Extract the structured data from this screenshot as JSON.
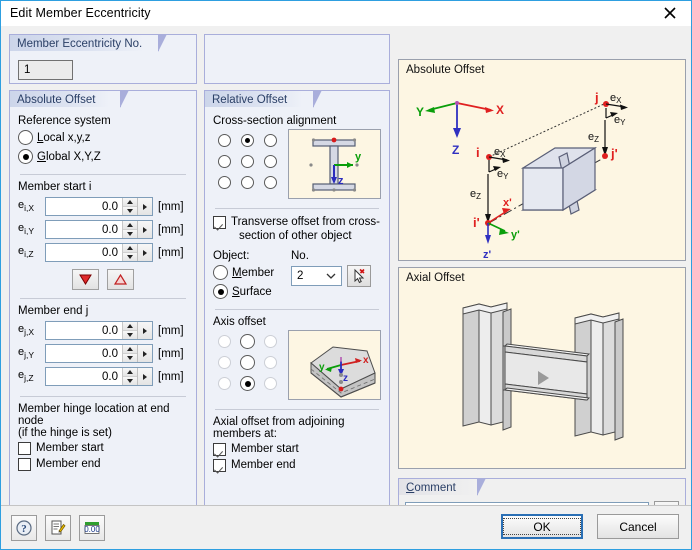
{
  "window": {
    "title": "Edit Member Eccentricity",
    "close_icon": "close-icon"
  },
  "eccentricity_no": {
    "group_title": "Member Eccentricity No.",
    "value": "1"
  },
  "absolute_offset": {
    "group_title": "Absolute Offset",
    "reference_system_label": "Reference system",
    "options": [
      {
        "label": "Local x,y,z",
        "selected": false
      },
      {
        "label": "Global X,Y,Z",
        "selected": true
      }
    ],
    "member_start_label": "Member start i",
    "start_fields": [
      {
        "name": "e",
        "sub": "i,X",
        "value": "0.0",
        "unit": "[mm]"
      },
      {
        "name": "e",
        "sub": "i,Y",
        "value": "0.0",
        "unit": "[mm]"
      },
      {
        "name": "e",
        "sub": "i,Z",
        "value": "0.0",
        "unit": "[mm]"
      }
    ],
    "transfer_down_icon": "triangle-down-red-icon",
    "transfer_up_icon": "triangle-up-red-icon",
    "member_end_label": "Member end j",
    "end_fields": [
      {
        "name": "e",
        "sub": "j,X",
        "value": "0.0",
        "unit": "[mm]"
      },
      {
        "name": "e",
        "sub": "j,Y",
        "value": "0.0",
        "unit": "[mm]"
      },
      {
        "name": "e",
        "sub": "j,Z",
        "value": "0.0",
        "unit": "[mm]"
      }
    ],
    "hinge_label_line1": "Member hinge location at end node",
    "hinge_label_line2": "(if the hinge is set)",
    "hinge_options": [
      {
        "label": "Member start",
        "checked": false
      },
      {
        "label": "Member end",
        "checked": false
      }
    ]
  },
  "relative_offset": {
    "group_title": "Relative Offset",
    "cross_section_alignment_label": "Cross-section alignment",
    "cross_section_grid_selected_index": 1,
    "cross_section_preview_icon": "i-beam-section-icon",
    "cross_section_preview_axes": {
      "y": "y",
      "z": "z"
    },
    "transverse_offset_label_line1": "Transverse offset from cross-",
    "transverse_offset_label_line2": "section of other object",
    "transverse_offset_checked": true,
    "object_label": "Object:",
    "no_label": "No.",
    "object_options": [
      {
        "label": "Member",
        "selected": false
      },
      {
        "label": "Surface",
        "selected": true
      }
    ],
    "object_no_value": "2",
    "pick_icon": "pick-cursor-icon",
    "axis_offset_label": "Axis offset",
    "axis_offset_grid_selected_index": 7,
    "axis_offset_preview_icon": "surface-slab-icon",
    "axis_offset_preview_axes": {
      "x": "x",
      "y": "y",
      "z": "z"
    },
    "axial_label_line1": "Axial offset from adjoining",
    "axial_label_line2": "members at:",
    "axial_options": [
      {
        "label": "Member start",
        "checked": true
      },
      {
        "label": "Member end",
        "checked": true
      }
    ]
  },
  "graphics": {
    "absolute_offset": {
      "title": "Absolute Offset",
      "labels": {
        "global_x": "X",
        "global_y": "Y",
        "global_z": "Z",
        "node_i": "i",
        "node_i_prime": "i'",
        "node_j": "j",
        "node_j_prime": "j'",
        "local_x": "x'",
        "local_y": "y'",
        "local_z": "z'",
        "e_x": "e",
        "e_y": "e",
        "e_z": "e",
        "sub_x": "X",
        "sub_y": "Y",
        "sub_z": "Z"
      }
    },
    "axial_offset": {
      "title": "Axial Offset",
      "play_icon": "play-triangle-icon"
    }
  },
  "comment": {
    "label": "Comment",
    "value": "",
    "dropdown_icon": "chevron-down-icon",
    "copy_icon": "copy-pages-icon"
  },
  "footer": {
    "help_icon": "help-question-icon",
    "notes_icon": "edit-note-icon",
    "units_icon": "number-format-icon",
    "ok_label": "OK",
    "cancel_label": "Cancel"
  },
  "colors": {
    "accent": "#2e9fe0",
    "group_border": "#a9aedb",
    "group_bg": "#eef1f8",
    "graphic_bg": "#fdf6e3",
    "red": "#e03030",
    "green": "#00a000",
    "blue": "#3030c0"
  }
}
